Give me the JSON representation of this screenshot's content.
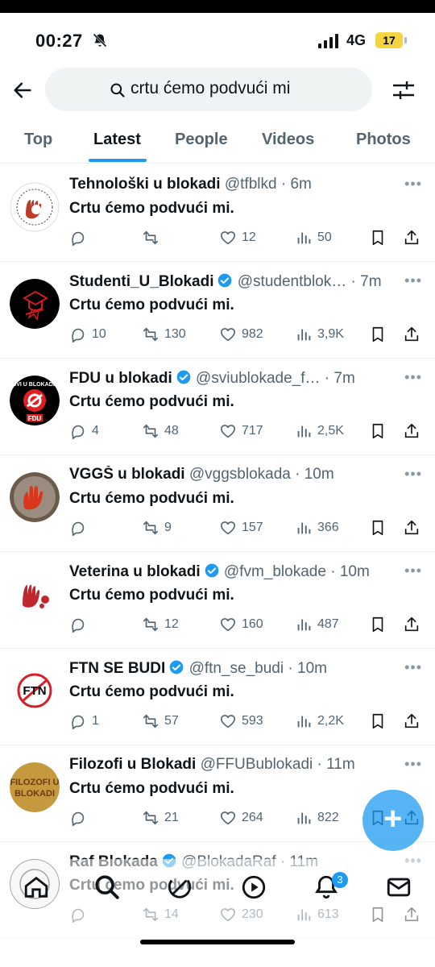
{
  "status_bar": {
    "time": "00:27",
    "network": "4G",
    "battery": "17"
  },
  "search": {
    "query": "crtu ćemo podvući mi"
  },
  "tabs": [
    {
      "label": "Top",
      "active": false
    },
    {
      "label": "Latest",
      "active": true
    },
    {
      "label": "People",
      "active": false
    },
    {
      "label": "Videos",
      "active": false
    },
    {
      "label": "Photos",
      "active": false
    }
  ],
  "tweets": [
    {
      "name": "Tehnološki u blokadi",
      "verified": false,
      "handle": "@tfblkd",
      "time": "6m",
      "text": "Crtu ćemo podvući mi.",
      "replies": "",
      "retweets": "",
      "likes": "12",
      "views": "50"
    },
    {
      "name": "Studenti_U_Blokadi",
      "verified": true,
      "handle": "@studentblok…",
      "time": "7m",
      "text": "Crtu ćemo podvući mi.",
      "replies": "10",
      "retweets": "130",
      "likes": "982",
      "views": "3,9K"
    },
    {
      "name": "FDU u blokadi",
      "verified": true,
      "handle": "@sviublokade_f…",
      "time": "7m",
      "text": "Crtu ćemo podvući mi.",
      "replies": "4",
      "retweets": "48",
      "likes": "717",
      "views": "2,5K"
    },
    {
      "name": "VGGŠ u blokadi",
      "verified": false,
      "handle": "@vggsblokada",
      "time": "10m",
      "text": "Crtu ćemo podvući mi.",
      "replies": "",
      "retweets": "9",
      "likes": "157",
      "views": "366"
    },
    {
      "name": "Veterina u blokadi",
      "verified": true,
      "handle": "@fvm_blokade",
      "time": "10m",
      "text": "Crtu ćemo podvući mi.",
      "replies": "",
      "retweets": "12",
      "likes": "160",
      "views": "487"
    },
    {
      "name": "FTN SE BUDI",
      "verified": true,
      "handle": "@ftn_se_budi",
      "time": "10m",
      "text": "Crtu ćemo podvući mi.",
      "replies": "1",
      "retweets": "57",
      "likes": "593",
      "views": "2,2K"
    },
    {
      "name": "Filozofi u Blokadi",
      "verified": false,
      "handle": "@FFUBublokadi",
      "time": "11m",
      "text": "Crtu ćemo podvući mi.",
      "replies": "",
      "retweets": "21",
      "likes": "264",
      "views": "822"
    },
    {
      "name": "Raf Blokada",
      "verified": true,
      "handle": "@BlokadaRaf",
      "time": "11m",
      "text": "Crtu ćemo podvući mi.",
      "replies": "",
      "retweets": "14",
      "likes": "230",
      "views": "613"
    }
  ],
  "avatars": {
    "tfblkd": {
      "text": "",
      "bg": "#ffffff",
      "accent": "#c0392b"
    },
    "studenti": {
      "text": "",
      "bg": "#000000",
      "accent": "#d01c1c"
    },
    "fdu": {
      "text_top": "SVI U BLOKADE",
      "text_bottom": "FDU",
      "bg": "#000000",
      "accent": "#e02020"
    },
    "vggs": {
      "text": "",
      "bg": "#6b5b4b",
      "accent": "#d9361c"
    },
    "veterina": {
      "text": "",
      "bg": "#ffffff",
      "accent": "#c0272d"
    },
    "ftn": {
      "text": "FTN",
      "bg": "#ffffff",
      "accent": "#d61f26"
    },
    "filozofi": {
      "text_top": "FILOZOFI U",
      "text_bottom": "BLOKADI",
      "bg": "#c59a3e",
      "accent": "#6b3a12"
    }
  },
  "notifications": {
    "badge": "3"
  },
  "colors": {
    "accent": "#1d9bf0",
    "text": "#0f1419",
    "secondary": "#536471"
  }
}
